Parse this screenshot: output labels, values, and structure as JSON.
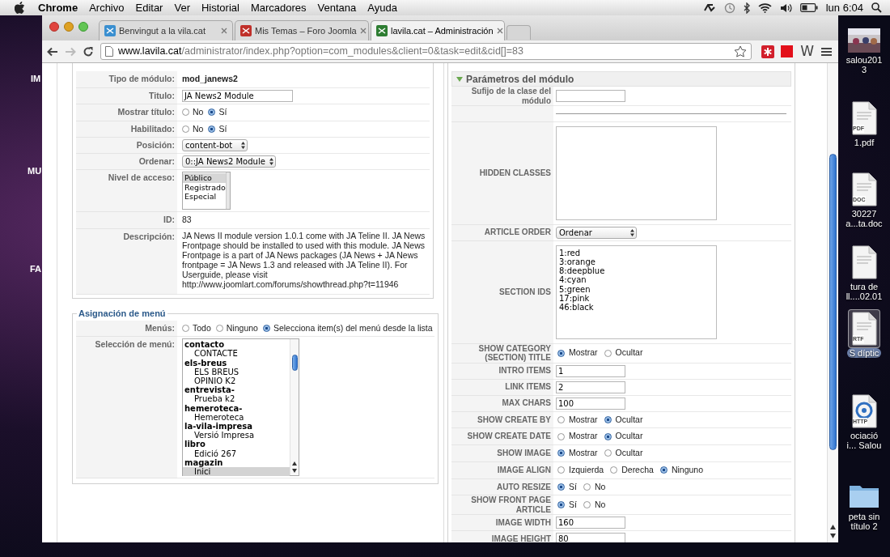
{
  "menubar": {
    "app": "Chrome",
    "items": [
      "Archivo",
      "Editar",
      "Ver",
      "Historial",
      "Marcadores",
      "Ventana",
      "Ayuda"
    ],
    "clock": "lun 6:04"
  },
  "desktop": {
    "left_labels": [
      "IM",
      "MU",
      "FA"
    ],
    "icons": [
      {
        "lines": [
          "salou201",
          "3"
        ]
      },
      {
        "kind": "document",
        "badge": "PDF",
        "lines": [
          "1.pdf"
        ]
      },
      {
        "kind": "document",
        "badge": "DOC",
        "lines": [
          "30227",
          "a...ta.doc"
        ]
      },
      {
        "kind": "document",
        "lines": [
          "tura de",
          "ll....02.01"
        ]
      },
      {
        "kind": "document",
        "badge": "RTF",
        "lines": [
          "S díptic"
        ],
        "selected": true
      },
      {
        "kind": "web",
        "badge": "HTTP",
        "lines": [
          "ociació",
          "i... Salou"
        ]
      },
      {
        "kind": "folder",
        "lines": [
          "peta sin",
          "título 2"
        ]
      }
    ]
  },
  "browser": {
    "tabs": [
      {
        "title": "Benvingut a la vila.cat",
        "selected": false,
        "color": "#3a8fd0"
      },
      {
        "title": "Mis Temas – Foro Joomla",
        "selected": false,
        "color": "#c0302a"
      },
      {
        "title": "lavila.cat – Administración",
        "selected": true,
        "color": "#2e7d32"
      }
    ],
    "url_host": "www.lavila.cat",
    "url_path": "/administrator/index.php?option=com_modules&client=0&task=edit&cid[]=83",
    "extensions": [
      {
        "kind": "asterisk"
      },
      {
        "kind": "square"
      },
      {
        "kind": "letter",
        "text": "W"
      }
    ]
  },
  "details": {
    "rows": [
      {
        "kind": "static",
        "label": "Tipo de módulo:",
        "value": "mod_janews2",
        "bold": true
      },
      {
        "kind": "input",
        "label": "Titulo:",
        "value": "JA News2 Module"
      },
      {
        "kind": "radio",
        "label": "Mostrar título:",
        "options": [
          {
            "label": "No",
            "selected": false
          },
          {
            "label": "Sí",
            "selected": true
          }
        ]
      },
      {
        "kind": "radio",
        "label": "Habilitado:",
        "options": [
          {
            "label": "No",
            "selected": false
          },
          {
            "label": "Sí",
            "selected": true
          }
        ]
      },
      {
        "kind": "select",
        "label": "Posición:",
        "value": "content-bot"
      },
      {
        "kind": "select",
        "label": "Ordenar:",
        "value": "0::JA News2 Module"
      },
      {
        "kind": "listbox",
        "label": "Nivel de acceso:",
        "options": [
          {
            "label": "Público",
            "selected": true
          },
          {
            "label": "Registrado",
            "selected": false
          },
          {
            "label": "Especial",
            "selected": false
          }
        ]
      },
      {
        "kind": "static",
        "label": "ID:",
        "value": "83",
        "bold": false
      },
      {
        "kind": "paragraph",
        "label": "Descripción:",
        "value": "JA News II module version 1.0.1 come with JA Teline II. JA News Frontpage should be installed to used with this module. JA News Frontpage is a part of JA News packages (JA News + JA News frontpage = JA News 1.3 and released with JA Teline II). For Userguide, please visit http://www.joomlart.com/forums/showthread.php?t=11946"
      }
    ]
  },
  "menu_assignment": {
    "title": "Asignación de menú",
    "rows": [
      {
        "kind": "radio",
        "label": "Menús:",
        "options": [
          {
            "label": "Todo",
            "selected": false
          },
          {
            "label": "Ninguno",
            "selected": false
          },
          {
            "label": "Selecciona item(s) del menú desde la lista",
            "selected": true
          }
        ]
      },
      {
        "kind": "tree",
        "label": "Selección de menú:",
        "groups": [
          {
            "label": "contacto",
            "children": [
              {
                "label": "CONTACTE",
                "selected": false
              }
            ]
          },
          {
            "label": "els-breus",
            "children": [
              {
                "label": "ELS BREUS",
                "selected": false
              },
              {
                "label": "OPINIO K2",
                "selected": false
              }
            ]
          },
          {
            "label": "entrevista-",
            "children": [
              {
                "label": "Prueba k2",
                "selected": false
              }
            ]
          },
          {
            "label": "hemeroteca-",
            "children": [
              {
                "label": "Hemeroteca",
                "selected": false
              }
            ]
          },
          {
            "label": "la-vila-impresa",
            "children": [
              {
                "label": "Versió Impresa",
                "selected": false
              }
            ]
          },
          {
            "label": "libro",
            "children": [
              {
                "label": "Edició 267",
                "selected": false
              }
            ]
          },
          {
            "label": "magazin",
            "children": [
              {
                "label": "Inici",
                "selected": true
              }
            ]
          }
        ]
      }
    ]
  },
  "parameters": {
    "title": "Parámetros del módulo",
    "expanded": true,
    "rows": [
      {
        "kind": "input",
        "label": "Sufijo de la clase del módulo"
      },
      {
        "kind": "rule"
      },
      {
        "kind": "textarea",
        "label": "HIDDEN CLASSES"
      },
      {
        "kind": "select",
        "label": "ARTICLE ORDER",
        "value": "Ordenar"
      },
      {
        "kind": "textarea",
        "label": "SECTION IDS",
        "lines": [
          "1:red",
          "3:orange",
          "8:deepblue",
          "4:cyan",
          "5:green",
          "17:pink",
          "46:black"
        ]
      },
      {
        "kind": "radio",
        "label": "SHOW CATEGORY (SECTION) TITLE",
        "options": [
          {
            "label": "Mostrar",
            "selected": true
          },
          {
            "label": "Ocultar",
            "selected": false
          }
        ]
      },
      {
        "kind": "input",
        "label": "INTRO ITEMS",
        "value": "1"
      },
      {
        "kind": "input",
        "label": "LINK ITEMS",
        "value": "2"
      },
      {
        "kind": "input",
        "label": "MAX CHARS",
        "value": "100"
      },
      {
        "kind": "radio",
        "label": "SHOW CREATE BY",
        "options": [
          {
            "label": "Mostrar",
            "selected": false
          },
          {
            "label": "Ocultar",
            "selected": true
          }
        ]
      },
      {
        "kind": "radio",
        "label": "SHOW CREATE DATE",
        "options": [
          {
            "label": "Mostrar",
            "selected": false
          },
          {
            "label": "Ocultar",
            "selected": true
          }
        ]
      },
      {
        "kind": "radio",
        "label": "SHOW IMAGE",
        "options": [
          {
            "label": "Mostrar",
            "selected": true
          },
          {
            "label": "Ocultar",
            "selected": false
          }
        ]
      },
      {
        "kind": "radio",
        "label": "IMAGE ALIGN",
        "options": [
          {
            "label": "Izquierda",
            "selected": false
          },
          {
            "label": "Derecha",
            "selected": false
          },
          {
            "label": "Ninguno",
            "selected": true
          }
        ]
      },
      {
        "kind": "radio",
        "label": "AUTO RESIZE",
        "options": [
          {
            "label": "Sí",
            "selected": true
          },
          {
            "label": "No",
            "selected": false
          }
        ]
      },
      {
        "kind": "radio",
        "label": "SHOW FRONT PAGE ARTICLE",
        "options": [
          {
            "label": "Sí",
            "selected": true
          },
          {
            "label": "No",
            "selected": false
          }
        ]
      },
      {
        "kind": "input",
        "label": "IMAGE WIDTH",
        "value": "160"
      },
      {
        "kind": "input",
        "label": "IMAGE HEIGHT",
        "value": "80"
      }
    ]
  }
}
